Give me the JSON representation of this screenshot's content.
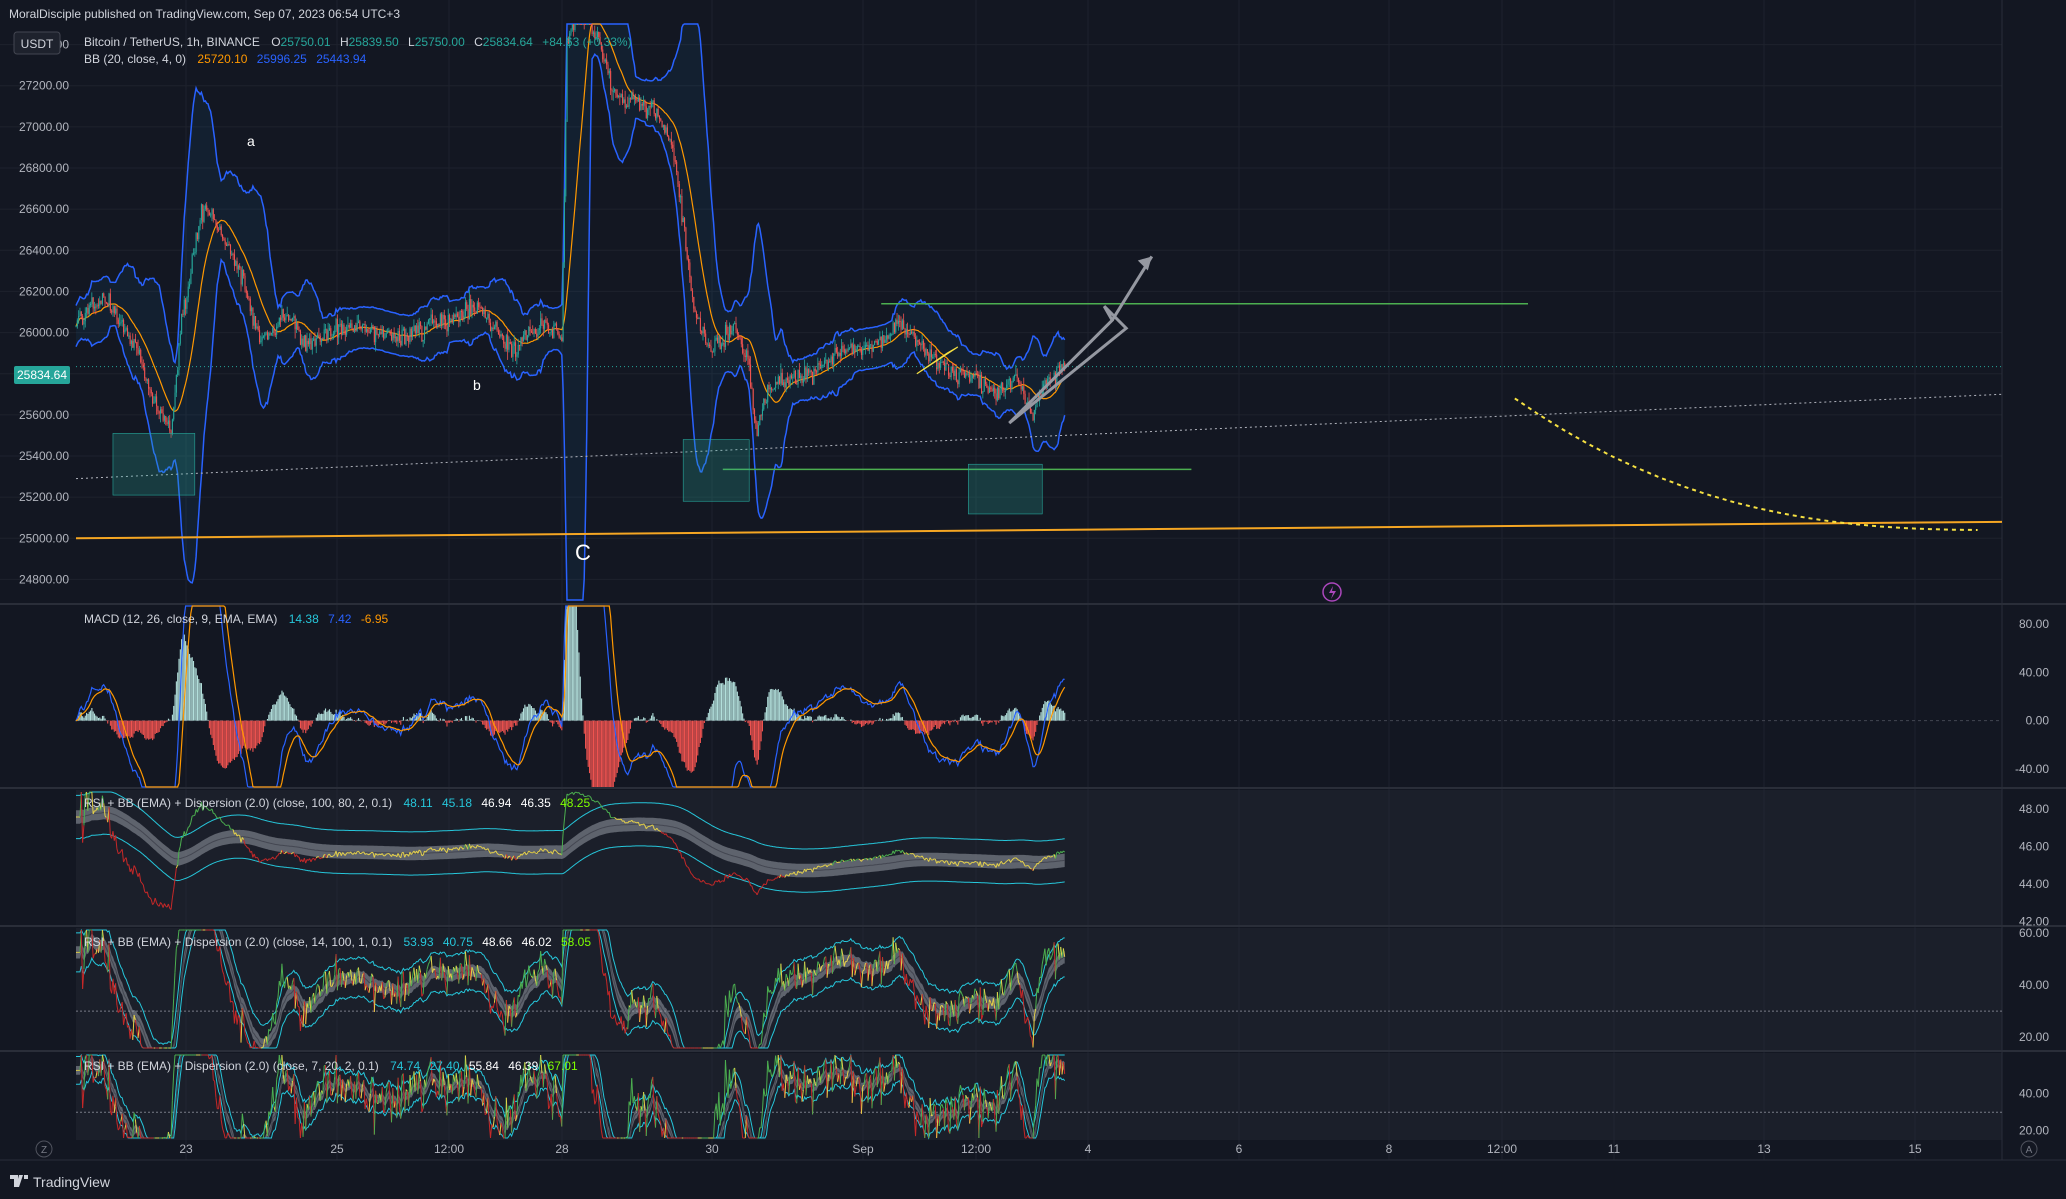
{
  "header": {
    "published": "MoralDisciple published on TradingView.com, Sep 07, 2023 06:54 UTC+3",
    "currency": "USDT"
  },
  "legend": {
    "symbol": "Bitcoin / TetherUS, 1h, BINANCE",
    "o_label": "O",
    "o": "25750.01",
    "h_label": "H",
    "h": "25839.50",
    "l_label": "L",
    "l": "25750.00",
    "c_label": "C",
    "c": "25834.64",
    "change": "+84.63 (+0.33%)",
    "bb_label": "BB (20, close, 4, 0)",
    "bb_basis": "25720.10",
    "bb_upper": "25996.25",
    "bb_lower": "25443.94",
    "macd_label": "MACD (12, 26, close, 9, EMA, EMA)",
    "macd_hist": "14.38",
    "macd_line": "7.42",
    "macd_signal": "-6.95",
    "rsi1_label": "RSI + BB (EMA) + Dispersion (2.0) (close, 100, 80, 2, 0.1)",
    "rsi1_vals": [
      "48.11",
      "45.18",
      "46.94",
      "46.35",
      "48.25"
    ],
    "rsi2_label": "RSI + BB (EMA) + Dispersion (2.0) (close, 14, 100, 1, 0.1)",
    "rsi2_vals": [
      "53.93",
      "40.75",
      "48.66",
      "46.02",
      "58.05"
    ],
    "rsi3_label": "RSI + BB (EMA) + Dispersion (2.0) (close, 7, 20, 2, 0.1)",
    "rsi3_vals": [
      "74.74",
      "27.40",
      "55.84",
      "46.39",
      "67.01"
    ]
  },
  "price_badge": "25834.64",
  "annotations": {
    "a": "a",
    "b": "b",
    "c": "C"
  },
  "footer": {
    "brand": "TradingView",
    "z": "Z",
    "a": "A"
  },
  "colors": {
    "bg": "#131722",
    "up": "#26a69a",
    "down": "#ef5350",
    "bb": "#2962ff",
    "basis": "#ff9800",
    "green": "#4caf50",
    "orange": "#f5a623",
    "yellow": "#f5e042",
    "rsi_teal": "#26c6da",
    "rsi_green": "#4caf50",
    "rsi_yellow": "#e5d14a",
    "rsi_red": "#c62828"
  },
  "chart_data": [
    {
      "type": "candlestick",
      "title": "Bitcoin / TetherUS, 1h, BINANCE",
      "ylabel": "USDT",
      "ylim": [
        24700,
        27500
      ],
      "y_ticks": [
        24800,
        25000,
        25200,
        25400,
        25600,
        25800,
        26000,
        26200,
        26400,
        26600,
        26800,
        27000,
        27200,
        27400
      ],
      "x_ticks": [
        "23",
        "25",
        "12:00",
        "28",
        "30",
        "Sep",
        "12:00",
        "4",
        "6",
        "8",
        "12:00",
        "11",
        "13",
        "15"
      ],
      "path": [
        [
          0,
          26050
        ],
        [
          20,
          26180
        ],
        [
          45,
          25950
        ],
        [
          60,
          25650
        ],
        [
          72,
          25520
        ],
        [
          80,
          26050
        ],
        [
          95,
          26600
        ],
        [
          110,
          26480
        ],
        [
          125,
          26280
        ],
        [
          140,
          25950
        ],
        [
          160,
          26100
        ],
        [
          175,
          25930
        ],
        [
          195,
          26020
        ],
        [
          225,
          26000
        ],
        [
          250,
          25980
        ],
        [
          275,
          26050
        ],
        [
          305,
          26120
        ],
        [
          330,
          25920
        ],
        [
          355,
          26060
        ],
        [
          368,
          25960
        ],
        [
          372,
          27400
        ],
        [
          380,
          27560
        ],
        [
          395,
          27450
        ],
        [
          408,
          27150
        ],
        [
          420,
          27120
        ],
        [
          438,
          27080
        ],
        [
          452,
          26900
        ],
        [
          460,
          26550
        ],
        [
          468,
          26100
        ],
        [
          480,
          25920
        ],
        [
          500,
          26020
        ],
        [
          510,
          25830
        ],
        [
          515,
          25500
        ],
        [
          525,
          25740
        ],
        [
          550,
          25780
        ],
        [
          580,
          25900
        ],
        [
          605,
          25950
        ],
        [
          625,
          26050
        ],
        [
          645,
          25900
        ],
        [
          665,
          25800
        ],
        [
          685,
          25750
        ],
        [
          700,
          25700
        ],
        [
          712,
          25800
        ],
        [
          725,
          25600
        ],
        [
          732,
          25740
        ],
        [
          740,
          25780
        ],
        [
          749,
          25835
        ]
      ],
      "close": 25834.64,
      "bollinger": {
        "basis": 25720.1,
        "upper": 25996.25,
        "lower": 25443.94
      },
      "levels": [
        {
          "name": "range-top",
          "y": 26140
        },
        {
          "name": "range-bottom",
          "y": 25335
        },
        {
          "name": "C",
          "y_start": 25000,
          "y_end": 25080
        }
      ]
    },
    {
      "type": "bar",
      "title": "MACD (12, 26, close, 9, EMA, EMA)",
      "ylim": [
        -55,
        95
      ],
      "y_ticks": [
        -40,
        0,
        40,
        80
      ],
      "values": [
        14.38,
        7.42,
        -6.95
      ]
    },
    {
      "type": "line",
      "title": "RSI + BB (EMA) + Dispersion (2.0) (close, 100, 80, 2, 0.1)",
      "ylim": [
        41.8,
        49
      ],
      "y_ticks": [
        42,
        44,
        46,
        48
      ],
      "values": [
        48.11,
        45.18,
        46.94,
        46.35,
        48.25
      ]
    },
    {
      "type": "line",
      "title": "RSI + BB (EMA) + Dispersion (2.0) (close, 14, 100, 1, 0.1)",
      "ylim": [
        15,
        62
      ],
      "y_ticks": [
        20,
        40,
        60
      ],
      "values": [
        53.93,
        40.75,
        48.66,
        46.02,
        58.05
      ]
    },
    {
      "type": "line",
      "title": "RSI + BB (EMA) + Dispersion (2.0) (close, 7, 20, 2, 0.1)",
      "ylim": [
        15,
        62
      ],
      "y_ticks": [
        20,
        40
      ],
      "values": [
        74.74,
        27.4,
        55.84,
        46.39,
        67.01
      ]
    }
  ]
}
